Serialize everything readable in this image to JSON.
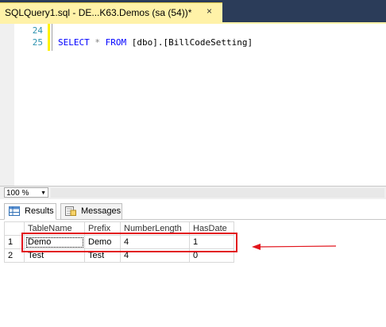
{
  "document_tab": {
    "title": "SQLQuery1.sql - DE...K63.Demos (sa (54))*",
    "close": "×"
  },
  "editor": {
    "lines": [
      {
        "number": "24",
        "code": ""
      },
      {
        "number": "25",
        "code_parts": [
          "SELECT",
          " * ",
          "FROM",
          " [dbo].[BillCodeSetting]"
        ]
      }
    ]
  },
  "zoom": {
    "value": "100 %"
  },
  "results_tabs": [
    {
      "label": "Results",
      "icon": "grid-icon",
      "active": true
    },
    {
      "label": "Messages",
      "icon": "messages-icon",
      "active": false
    }
  ],
  "grid": {
    "columns": [
      "TableName",
      "Prefix",
      "NumberLength",
      "HasDate"
    ],
    "rows": [
      {
        "num": "1",
        "cells": [
          "Demo",
          "Demo",
          "4",
          "1"
        ]
      },
      {
        "num": "2",
        "cells": [
          "Test",
          "Test",
          "4",
          "0"
        ]
      }
    ]
  },
  "colors": {
    "accent_red": "#e2141c",
    "tab_yellow": "#fff2a8",
    "tabstrip": "#2b3c59",
    "keyword": "#0000ff"
  }
}
